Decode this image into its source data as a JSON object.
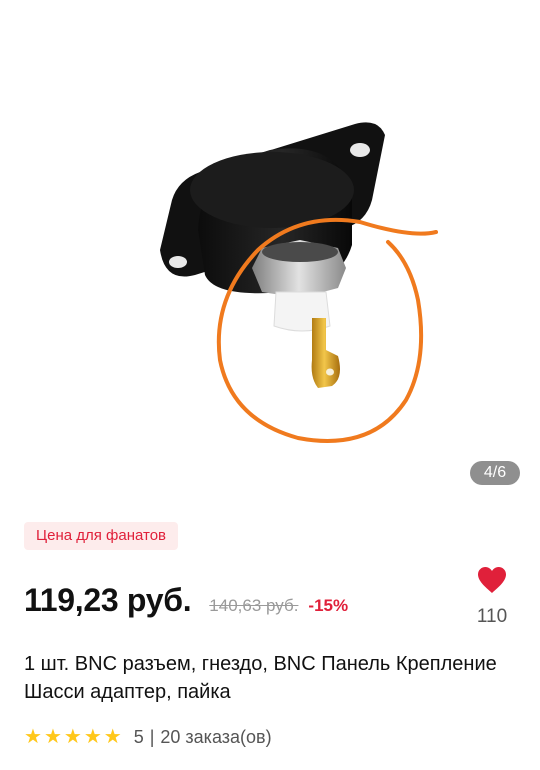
{
  "gallery": {
    "counter": "4/6"
  },
  "badge": {
    "label": "Цена для фанатов"
  },
  "price": {
    "current": "119,23 руб.",
    "old": "140,63 руб.",
    "discount": "-15%"
  },
  "wishlist": {
    "icon": "heart-icon",
    "count": "110",
    "color": "#e0203a"
  },
  "product": {
    "title": "1 шт. BNC разъем, гнездо, BNC Панель Крепление Шасси адаптер, пайка"
  },
  "rating": {
    "stars": 5,
    "score": "5",
    "separator": "|",
    "orders": "20 заказа(ов)",
    "star_color": "#ffc71a"
  }
}
